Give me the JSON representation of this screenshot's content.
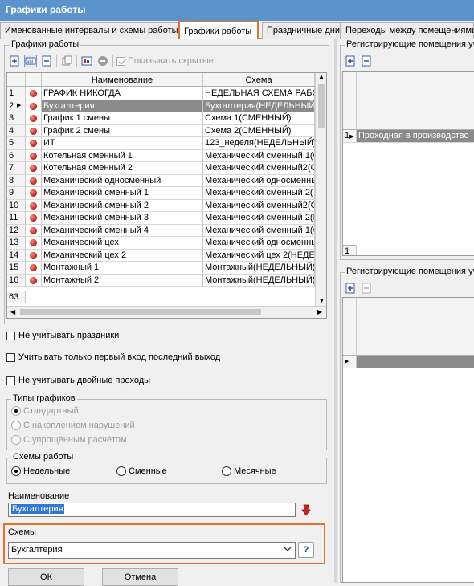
{
  "window": {
    "title": "Графики работы"
  },
  "tabs": [
    {
      "label": "Именованные интервалы и схемы работы"
    },
    {
      "label": "Графики работы"
    },
    {
      "label": "Праздничные дни"
    },
    {
      "label": "Переходы между помещениями"
    }
  ],
  "left": {
    "group_title": "Графики работы",
    "toolbar": {
      "show_hidden_label": "Показывать скрытые"
    },
    "grid": {
      "columns": [
        "Наименование",
        "Схема"
      ],
      "rows": [
        {
          "num": "1",
          "name": "ГРАФИК НИКОГДА",
          "scheme": "НЕДЕЛЬНАЯ СХЕМА РАБОТЫ"
        },
        {
          "num": "2",
          "name": "Бухгалтерия",
          "scheme": "Бухгалтерия(НЕДЕЛЬНЫЙ)"
        },
        {
          "num": "3",
          "name": "График 1 смены",
          "scheme": "Схема 1(СМЕННЫЙ)"
        },
        {
          "num": "4",
          "name": "График 2 смены",
          "scheme": "Схема 2(СМЕННЫЙ)"
        },
        {
          "num": "5",
          "name": "ИТ",
          "scheme": "123_неделя(НЕДЕЛЬНЫЙ)"
        },
        {
          "num": "6",
          "name": "Котельная сменный 1",
          "scheme": "Механический сменный 1(С"
        },
        {
          "num": "7",
          "name": "Котельная сменный 2",
          "scheme": "Механический сменный2(СМ"
        },
        {
          "num": "8",
          "name": "Механический односменный",
          "scheme": "Механический односменны"
        },
        {
          "num": "9",
          "name": "Механический сменный 1",
          "scheme": "Механический сменный   2("
        },
        {
          "num": "10",
          "name": "Механический сменный 2",
          "scheme": "Механический сменный2(СМ"
        },
        {
          "num": "11",
          "name": "Механический сменный 3",
          "scheme": "Механический сменный 2(Н"
        },
        {
          "num": "12",
          "name": "Механический сменный 4",
          "scheme": "Механический сменный 1(С"
        },
        {
          "num": "13",
          "name": "Механический цех",
          "scheme": "Механический односменны"
        },
        {
          "num": "14",
          "name": "Механический цех 2",
          "scheme": "Механический цех 2(НЕДЕЛ"
        },
        {
          "num": "15",
          "name": "Монтажный 1",
          "scheme": "Монтажный(НЕДЕЛЬНЫЙ)"
        },
        {
          "num": "16",
          "name": "Монтажный 2",
          "scheme": "Монтажный(НЕДЕЛЬНЫЙ)"
        }
      ],
      "total": "63"
    },
    "options": {
      "ignore_holidays": "Не учитывать праздники",
      "first_last_only": "Учитывать только первый вход последний выход",
      "ignore_double": "Не учитывать двойные проходы"
    },
    "schedule_types": {
      "title": "Типы графиков",
      "items": [
        "Стандартный",
        "С накоплением нарушений",
        "С упрощённым расчётом"
      ]
    },
    "work_schemes": {
      "title": "Схемы работы",
      "items": [
        "Недельные",
        "Сменные",
        "Месячные"
      ]
    },
    "name_field": {
      "label": "Наименование",
      "value": "Бухгалтерия"
    },
    "schemes_field": {
      "label": "Схемы",
      "value": "Бухгалтерия",
      "help": "?"
    },
    "ok_label": "ОК",
    "cancel_label": "Отмена"
  },
  "right": {
    "top_title": "Регистрирующие помещения уч",
    "top_row": {
      "num": "1",
      "text": "Проходная в производство"
    },
    "top_footer": "1",
    "bottom_title": "Регистрирующие помещения уч"
  },
  "colors": {
    "title_bar": "#5b93cb",
    "highlight": "#e0742e",
    "selection": "#8a8a8a"
  }
}
